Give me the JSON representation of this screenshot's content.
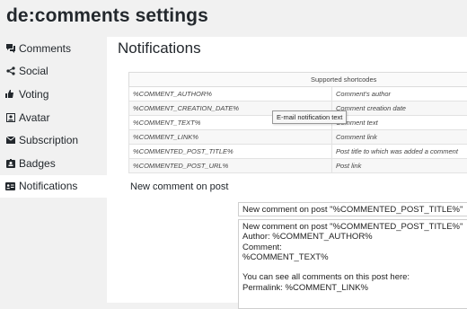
{
  "page": {
    "title": "de:comments settings"
  },
  "sidebar": {
    "items": [
      {
        "label": "Comments",
        "icon": "comments-icon"
      },
      {
        "label": "Social",
        "icon": "share-icon"
      },
      {
        "label": "Voting",
        "icon": "thumbs-icon"
      },
      {
        "label": "Avatar",
        "icon": "avatar-icon"
      },
      {
        "label": "Subscription",
        "icon": "envelope-icon"
      },
      {
        "label": "Badges",
        "icon": "badge-icon"
      },
      {
        "label": "Notifications",
        "icon": "id-card-icon",
        "active": true
      }
    ]
  },
  "main": {
    "title": "Notifications",
    "shortcodes": {
      "header": "Supported shortcodes",
      "rows": [
        {
          "code": "%COMMENT_AUTHOR%",
          "desc": "Comment's author"
        },
        {
          "code": "%COMMENT_CREATION_DATE%",
          "desc": "Comment creation date"
        },
        {
          "code": "%COMMENT_TEXT%",
          "desc": "Comment text"
        },
        {
          "code": "%COMMENT_LINK%",
          "desc": "Comment link"
        },
        {
          "code": "%COMMENTED_POST_TITLE%",
          "desc": "Post title to which was added a comment"
        },
        {
          "code": "%COMMENTED_POST_URL%",
          "desc": "Post link"
        }
      ]
    },
    "tooltip": "E-mail notification text",
    "section_label": "New comment on post",
    "subject_value": "New comment on post \"%COMMENTED_POST_TITLE%\"",
    "body_value": "New comment on post \"%COMMENTED_POST_TITLE%\"\nAuthor: %COMMENT_AUTHOR%\nComment:\n%COMMENT_TEXT%\n\nYou can see all comments on this post here:\nPermalink: %COMMENT_LINK%"
  }
}
